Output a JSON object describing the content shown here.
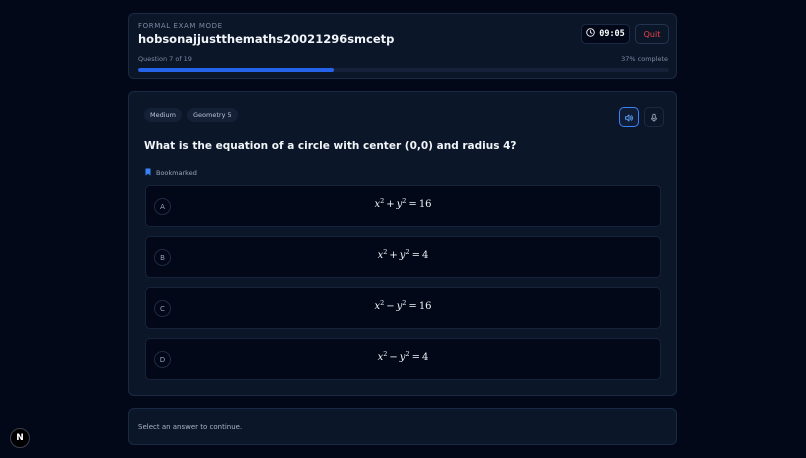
{
  "header": {
    "mode_label": "FORMAL EXAM MODE",
    "title": "hobsonajjustthemaths20021296smcetp",
    "timer": "09:05",
    "quit_label": "Quit",
    "question_progress": "Question 7 of 19",
    "percent_label": "37% complete",
    "progress_fraction": 0.37
  },
  "question": {
    "tags": [
      "Medium",
      "Geometry 5"
    ],
    "text": "What is the equation of a circle with center (0,0) and radius 4?",
    "bookmark_label": "Bookmarked",
    "options": [
      {
        "letter": "A",
        "v1": "x",
        "e1": "2",
        "op": "+",
        "v2": "y",
        "e2": "2",
        "eq": "=",
        "rhs": "16"
      },
      {
        "letter": "B",
        "v1": "x",
        "e1": "2",
        "op": "+",
        "v2": "y",
        "e2": "2",
        "eq": "=",
        "rhs": "4"
      },
      {
        "letter": "C",
        "v1": "x",
        "e1": "2",
        "op": "−",
        "v2": "y",
        "e2": "2",
        "eq": "=",
        "rhs": "16"
      },
      {
        "letter": "D",
        "v1": "x",
        "e1": "2",
        "op": "−",
        "v2": "y",
        "e2": "2",
        "eq": "=",
        "rhs": "4"
      }
    ]
  },
  "footer": {
    "hint": "Select an answer to continue."
  },
  "badge": {
    "letter": "N"
  },
  "icons": {
    "timer": "clock-icon",
    "audio": "speaker-icon",
    "mic": "microphone-icon",
    "bookmark": "bookmark-icon"
  },
  "colors": {
    "accent": "#2563eb",
    "quit": "#ef4444",
    "background": "#020817"
  }
}
